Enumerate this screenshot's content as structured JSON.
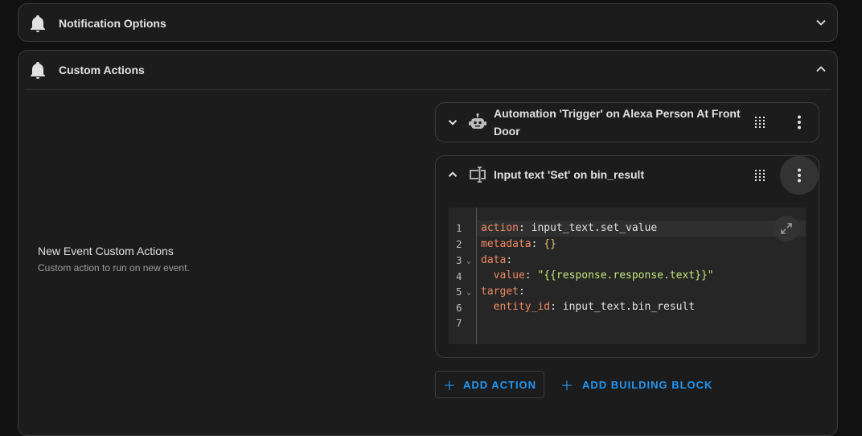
{
  "notification_panel": {
    "title": "Notification Options",
    "icon": "bell-icon",
    "expanded": false
  },
  "custom_panel": {
    "title": "Custom Actions",
    "icon": "bell-icon",
    "expanded": true,
    "label": "New Event Custom Actions",
    "description": "Custom action to run on new event."
  },
  "actions": [
    {
      "title": "Automation 'Trigger' on Alexa Person At Front Door",
      "icon": "robot-icon",
      "expanded": false
    },
    {
      "title": "Input text 'Set' on bin_result",
      "icon": "input-text-icon",
      "expanded": true
    }
  ],
  "editor": {
    "line_numbers": [
      "1",
      "2",
      "3",
      "4",
      "5",
      "6",
      "7"
    ],
    "lines": [
      {
        "key": "action",
        "value": "input_text.set_value"
      },
      {
        "key": "metadata",
        "value": "{}"
      },
      {
        "key": "data",
        "value": ""
      },
      {
        "key": "value",
        "value": "\"{{response.response.text}}\""
      },
      {
        "key": "target",
        "value": ""
      },
      {
        "key": "entity_id",
        "value": "input_text.bin_result"
      }
    ]
  },
  "buttons": {
    "add_action": "ADD ACTION",
    "add_building_block": "ADD BUILDING BLOCK"
  },
  "colors": {
    "accent": "#2196f3",
    "background": "#111111",
    "card": "#1c1c1c",
    "yaml_key": "#ef8a62",
    "yaml_string": "#c5e478"
  }
}
